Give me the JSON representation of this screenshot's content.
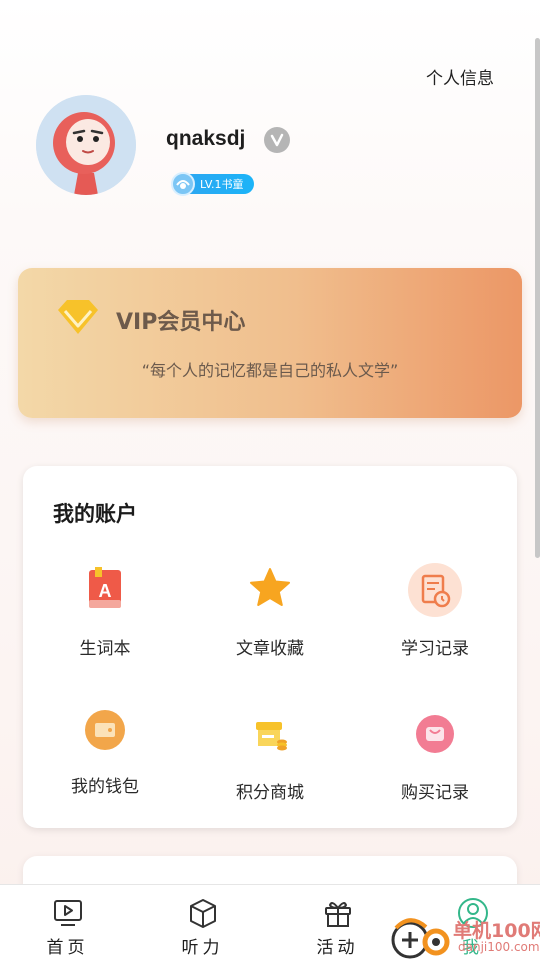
{
  "header": {
    "personal_info_label": "个人信息"
  },
  "profile": {
    "username": "qnaksdj",
    "level_badge": "LV.1书童",
    "verify_icon": "verified-v-icon",
    "avatar_icon": "cartoon-avatar-icon"
  },
  "vip": {
    "title": "VIP会员中心",
    "quote": "“每个人的记忆都是自己的私人文学”",
    "icon": "diamond-icon",
    "gradient": [
      "#f3d8a8",
      "#f0be8d",
      "#ec9766"
    ]
  },
  "account": {
    "title": "我的账户",
    "items": [
      {
        "label": "生词本",
        "icon": "vocabulary-book-icon"
      },
      {
        "label": "文章收藏",
        "icon": "star-icon"
      },
      {
        "label": "学习记录",
        "icon": "study-record-icon"
      },
      {
        "label": "我的钱包",
        "icon": "wallet-icon"
      },
      {
        "label": "积分商城",
        "icon": "points-shop-icon"
      },
      {
        "label": "购买记录",
        "icon": "purchase-bag-icon"
      }
    ]
  },
  "nav": {
    "items": [
      {
        "label": "首页",
        "icon": "play-screen-icon"
      },
      {
        "label": "听力",
        "icon": "open-box-icon"
      },
      {
        "label": "活动",
        "icon": "gift-icon"
      },
      {
        "label": "我",
        "icon": "user-icon"
      }
    ],
    "active_color": "#33b78a"
  },
  "watermark": {
    "line1": "单机100网",
    "line2": "danji100.com"
  }
}
